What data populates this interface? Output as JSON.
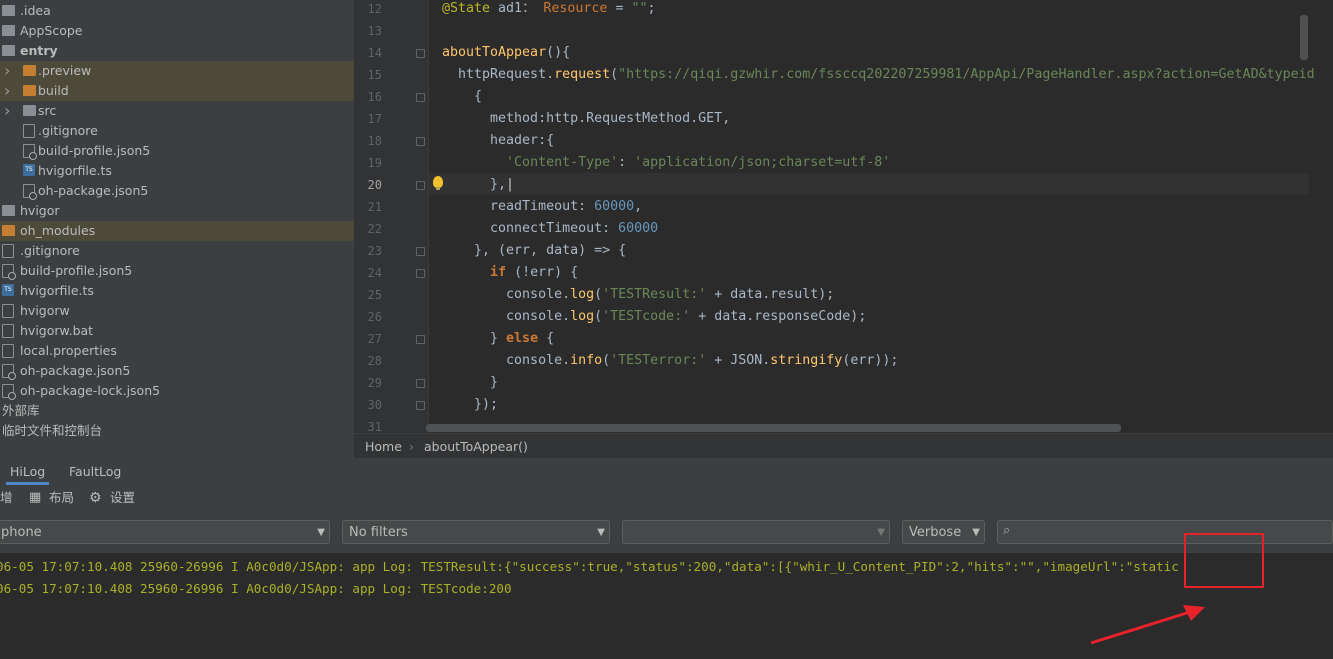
{
  "project_tree": {
    "items": [
      {
        "label": ".idea",
        "icon": "folder-icon",
        "indent": 0
      },
      {
        "label": "AppScope",
        "icon": "folder-icon",
        "indent": 0
      },
      {
        "label": "entry",
        "icon": "folder-icon",
        "indent": 0,
        "bold": true
      },
      {
        "label": ".preview",
        "icon": "folder-orange-icon",
        "indent": 1,
        "arrow": true,
        "highlight": true
      },
      {
        "label": "build",
        "icon": "folder-orange-icon",
        "indent": 1,
        "arrow": true,
        "highlight": true
      },
      {
        "label": "src",
        "icon": "folder-icon",
        "indent": 1,
        "arrow": true
      },
      {
        "label": ".gitignore",
        "icon": "file-icon",
        "indent": 1
      },
      {
        "label": "build-profile.json5",
        "icon": "json-icon",
        "indent": 1
      },
      {
        "label": "hvigorfile.ts",
        "icon": "ts-icon",
        "indent": 1
      },
      {
        "label": "oh-package.json5",
        "icon": "json-icon",
        "indent": 1
      },
      {
        "label": "hvigor",
        "icon": "folder-icon",
        "indent": 0
      },
      {
        "label": "oh_modules",
        "icon": "folder-orange-icon",
        "indent": 0,
        "highlight": true
      },
      {
        "label": ".gitignore",
        "icon": "file-icon",
        "indent": 0
      },
      {
        "label": "build-profile.json5",
        "icon": "json-icon",
        "indent": 0
      },
      {
        "label": "hvigorfile.ts",
        "icon": "ts-icon",
        "indent": 0
      },
      {
        "label": "hvigorw",
        "icon": "file-icon",
        "indent": 0
      },
      {
        "label": "hvigorw.bat",
        "icon": "file-icon",
        "indent": 0
      },
      {
        "label": "local.properties",
        "icon": "file-icon",
        "indent": 0
      },
      {
        "label": "oh-package.json5",
        "icon": "json-icon",
        "indent": 0
      },
      {
        "label": "oh-package-lock.json5",
        "icon": "json-icon",
        "indent": 0
      },
      {
        "label": "外部库",
        "icon": "",
        "indent": -1
      },
      {
        "label": "临时文件和控制台",
        "icon": "",
        "indent": -1
      }
    ]
  },
  "editor": {
    "current_line": 20,
    "lines": [
      {
        "num": 12,
        "fold": false,
        "tokens": [
          [
            "dec",
            "@State "
          ],
          [
            "cls",
            "ad1"
          ],
          [
            "",
            "： "
          ],
          [
            "typ",
            "Resource"
          ],
          [
            "",
            " = "
          ],
          [
            "s",
            "\"\""
          ],
          [
            "",
            ";"
          ]
        ]
      },
      {
        "num": 13,
        "fold": false,
        "tokens": []
      },
      {
        "num": 14,
        "fold": true,
        "tokens": [
          [
            "f",
            "aboutToAppear"
          ],
          [
            "",
            "(){"
          ]
        ]
      },
      {
        "num": 15,
        "fold": false,
        "tokens": [
          [
            "",
            "  httpRequest."
          ],
          [
            "f",
            "request"
          ],
          [
            "",
            "("
          ],
          [
            "s",
            "\"https://qiqi.gzwhir.com/fssccq202207259981/AppApi/PageHandler.aspx?action=GetAD&typeid"
          ]
        ]
      },
      {
        "num": 16,
        "fold": true,
        "tokens": [
          [
            "",
            "    {"
          ]
        ]
      },
      {
        "num": 17,
        "fold": false,
        "tokens": [
          [
            "",
            "      method:http.RequestMethod.GET,"
          ]
        ]
      },
      {
        "num": 18,
        "fold": true,
        "tokens": [
          [
            "",
            "      header:{"
          ]
        ]
      },
      {
        "num": 19,
        "fold": false,
        "tokens": [
          [
            "",
            "        "
          ],
          [
            "s",
            "'Content-Type'"
          ],
          [
            "",
            ": "
          ],
          [
            "s",
            "'application/json;charset=utf-8'"
          ]
        ]
      },
      {
        "num": 20,
        "fold": true,
        "tokens": [
          [
            "",
            "      },"
          ]
        ]
      },
      {
        "num": 21,
        "fold": false,
        "tokens": [
          [
            "",
            "      readTimeout: "
          ],
          [
            "n",
            "60000"
          ],
          [
            "",
            ","
          ]
        ]
      },
      {
        "num": 22,
        "fold": false,
        "tokens": [
          [
            "",
            "      connectTimeout: "
          ],
          [
            "n",
            "60000"
          ]
        ]
      },
      {
        "num": 23,
        "fold": true,
        "tokens": [
          [
            "",
            "    }, (err, data) => {"
          ]
        ]
      },
      {
        "num": 24,
        "fold": true,
        "tokens": [
          [
            "",
            "      "
          ],
          [
            "k",
            "if"
          ],
          [
            "",
            " (!err) {"
          ]
        ]
      },
      {
        "num": 25,
        "fold": false,
        "tokens": [
          [
            "",
            "        console."
          ],
          [
            "f",
            "log"
          ],
          [
            "",
            "("
          ],
          [
            "s",
            "'TESTResult:'"
          ],
          [
            "",
            " + data.result);"
          ]
        ]
      },
      {
        "num": 26,
        "fold": false,
        "tokens": [
          [
            "",
            "        console."
          ],
          [
            "f",
            "log"
          ],
          [
            "",
            "("
          ],
          [
            "s",
            "'TESTcode:'"
          ],
          [
            "",
            " + data.responseCode);"
          ]
        ]
      },
      {
        "num": 27,
        "fold": true,
        "tokens": [
          [
            "",
            "      } "
          ],
          [
            "k",
            "else"
          ],
          [
            "",
            " {"
          ]
        ]
      },
      {
        "num": 28,
        "fold": false,
        "tokens": [
          [
            "",
            "        console."
          ],
          [
            "f",
            "info"
          ],
          [
            "",
            "("
          ],
          [
            "s",
            "'TESTerror:'"
          ],
          [
            "",
            " + JSON."
          ],
          [
            "f",
            "stringify"
          ],
          [
            "",
            "(err));"
          ]
        ]
      },
      {
        "num": 29,
        "fold": true,
        "tokens": [
          [
            "",
            "      }"
          ]
        ]
      },
      {
        "num": 30,
        "fold": true,
        "tokens": [
          [
            "",
            "    });"
          ]
        ]
      },
      {
        "num": 31,
        "fold": false,
        "tokens": []
      }
    ]
  },
  "breadcrumb": {
    "home": "Home",
    "separator": "›",
    "method": "aboutToAppear()"
  },
  "bottom_panel": {
    "tabs": [
      {
        "label": "HiLog",
        "active": true
      },
      {
        "label": "FaultLog",
        "active": false
      }
    ],
    "toolbar": {
      "item1": "增",
      "layout": "布局",
      "settings": "设置"
    },
    "device_combo": "phone",
    "filter_combo": "No filters",
    "process_combo": "",
    "level_combo": "Verbose",
    "search_placeholder": "",
    "log_lines": [
      "06-05 17:07:10.408 25960-26996 I A0c0d0/JSApp: app Log: TESTResult:{\"success\":true,\"status\":200,\"data\":[{\"whir_U_Content_PID\":2,\"hits\":\"\",\"imageUrl\":\"static",
      "06-05 17:07:10.408 25960-26996 I A0c0d0/JSApp: app Log: TESTcode:200"
    ]
  },
  "annotation": {
    "box_color": "#e8222a",
    "arrow_color": "#e8222a"
  }
}
